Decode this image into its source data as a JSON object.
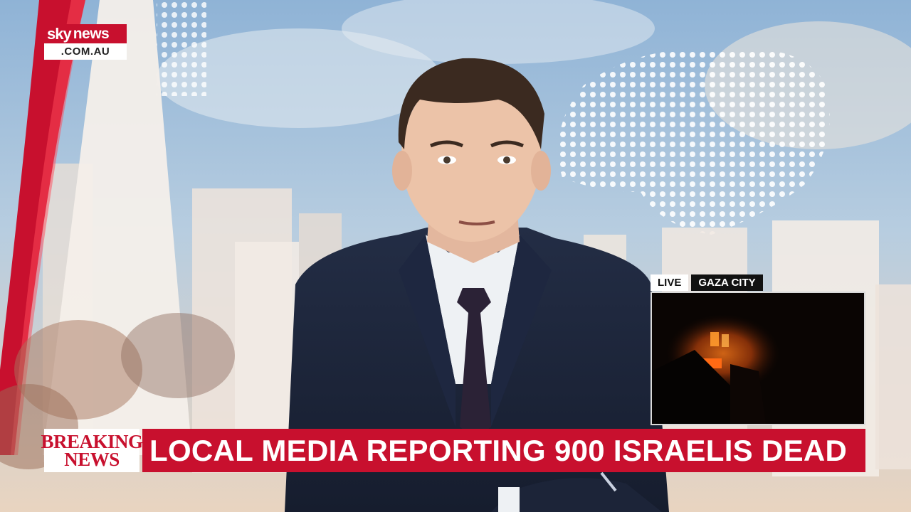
{
  "logo": {
    "brand_a": "sky",
    "brand_b": "news",
    "domain": ".COM.AU"
  },
  "pip": {
    "live_label": "LIVE",
    "location_label": "GAZA CITY"
  },
  "ticker": {
    "label_line1": "BREAKING",
    "label_line2": "NEWS",
    "headline": "LOCAL MEDIA REPORTING 900 ISRAELIS DEAD"
  },
  "colors": {
    "brand_red": "#c8102e",
    "ticker_label_bg": "#ffffff",
    "pip_tag_dark": "#111111"
  }
}
